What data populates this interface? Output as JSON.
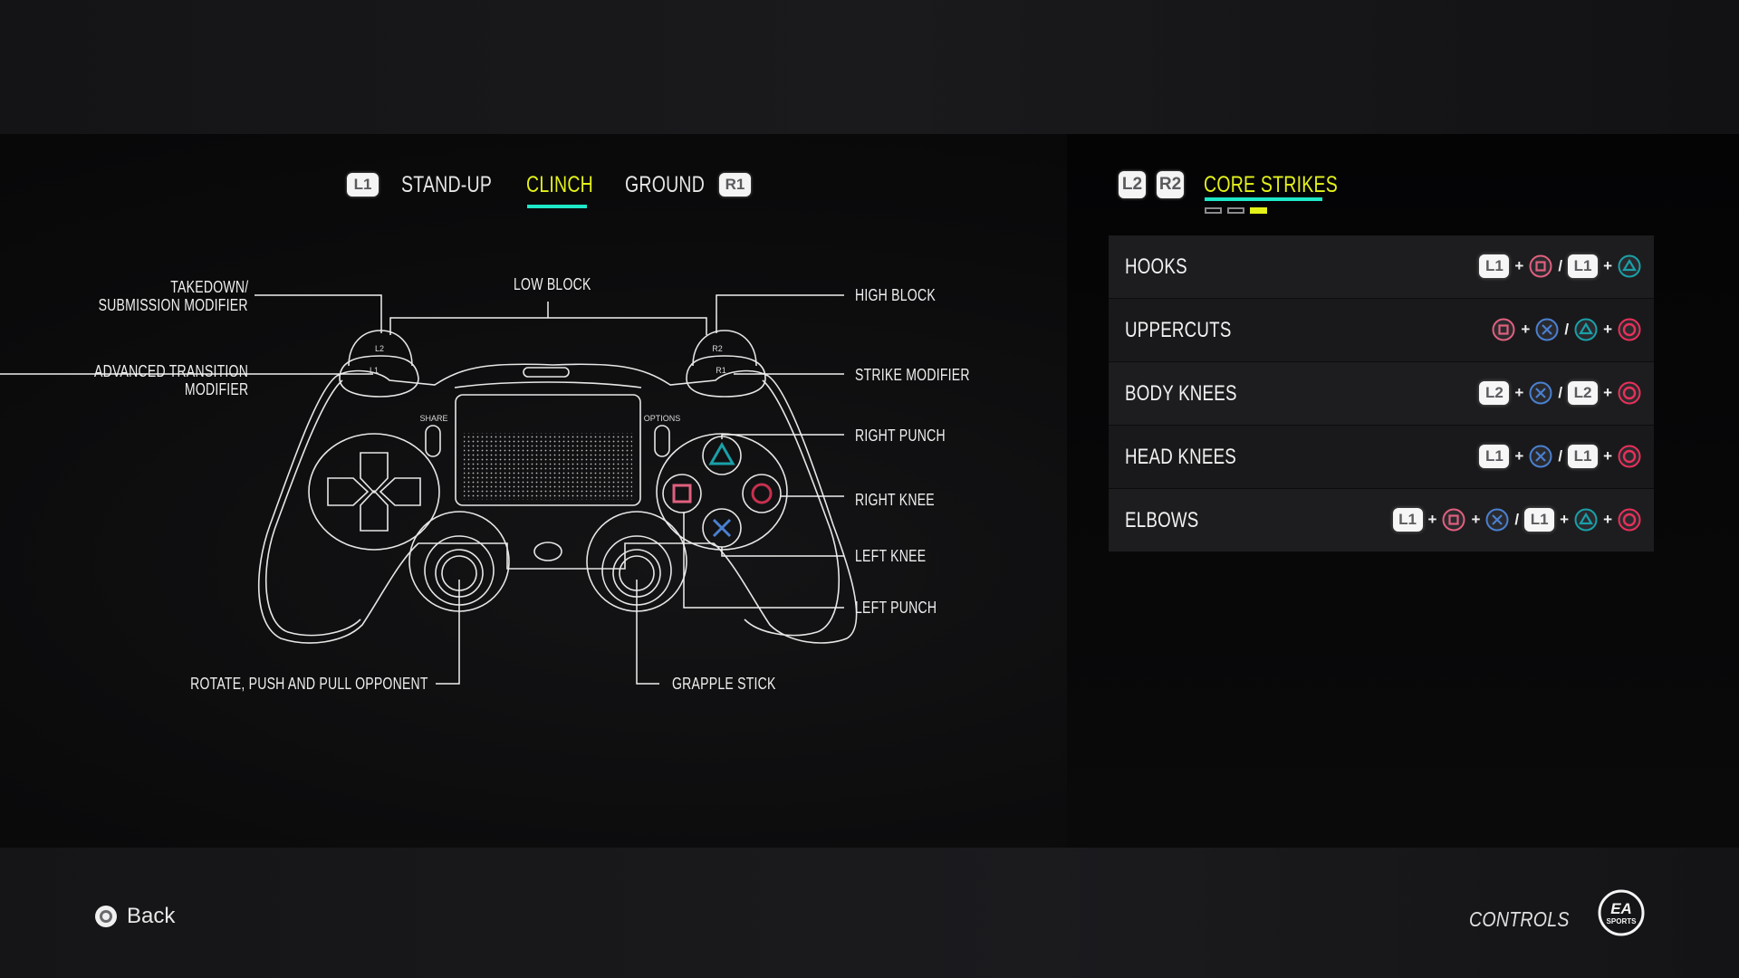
{
  "tabs": {
    "left_shoulder": "L1",
    "right_shoulder": "R1",
    "items": [
      {
        "label": "STAND-UP",
        "active": false
      },
      {
        "label": "CLINCH",
        "active": true
      },
      {
        "label": "GROUND",
        "active": false
      }
    ]
  },
  "controller": {
    "button_labels": {
      "l2": "L2",
      "l1": "L1",
      "r2": "R2",
      "r1": "R1",
      "share": "SHARE",
      "options": "OPTIONS"
    },
    "callouts": {
      "takedown_line1": "TAKEDOWN/",
      "takedown_line2": "SUBMISSION MODIFIER",
      "advanced_line1": "ADVANCED TRANSITION",
      "advanced_line2": "MODIFIER",
      "low_block": "LOW BLOCK",
      "high_block": "HIGH BLOCK",
      "strike_modifier": "STRIKE MODIFIER",
      "right_punch": "RIGHT PUNCH",
      "right_knee": "RIGHT KNEE",
      "left_knee": "LEFT KNEE",
      "left_punch": "LEFT PUNCH",
      "left_stick": "ROTATE, PUSH AND PULL OPPONENT",
      "right_stick": "GRAPPLE STICK"
    }
  },
  "panel": {
    "prev_key": "L2",
    "next_key": "R2",
    "title": "CORE STRIKES",
    "page": 3,
    "page_count": 3,
    "rows": [
      {
        "name": "HOOKS",
        "combo": [
          "L1",
          "+",
          "square",
          "/",
          "L1",
          "+",
          "triangle"
        ]
      },
      {
        "name": "UPPERCUTS",
        "combo": [
          "square",
          "+",
          "cross",
          "/",
          "triangle",
          "+",
          "circle"
        ]
      },
      {
        "name": "BODY KNEES",
        "combo": [
          "L2",
          "+",
          "cross",
          "/",
          "L2",
          "+",
          "circle"
        ]
      },
      {
        "name": "HEAD KNEES",
        "combo": [
          "L1",
          "+",
          "cross",
          "/",
          "L1",
          "+",
          "circle"
        ]
      },
      {
        "name": "ELBOWS",
        "combo": [
          "L1",
          "+",
          "square",
          "+",
          "cross",
          "/",
          "L1",
          "+",
          "triangle",
          "+",
          "circle"
        ]
      }
    ]
  },
  "footer": {
    "back_label": "Back",
    "back_icon": "circle-button-icon",
    "screen_title": "CONTROLS",
    "logo_line1": "EA",
    "logo_line2": "SPORTS"
  },
  "colors": {
    "accent_yellow": "#e4f21a",
    "accent_teal": "#1ee8c8",
    "square": "#e0607e",
    "cross": "#4a80d0",
    "triangle": "#1aa0a8",
    "circle": "#e8305a"
  }
}
